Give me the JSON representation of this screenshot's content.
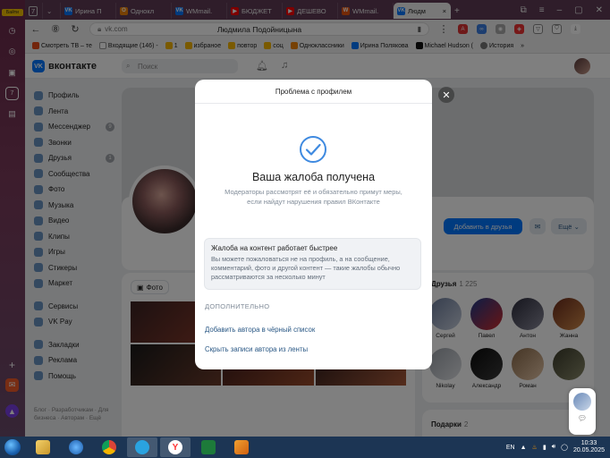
{
  "browser": {
    "weather_label": "Байти",
    "tab_counter": "7",
    "tabs": [
      {
        "label": "Ирина П",
        "color": "#0077ff",
        "glyph": "VK"
      },
      {
        "label": "Однокл",
        "color": "#ee8208",
        "glyph": "О"
      },
      {
        "label": "WMmail.",
        "color": "#0077ff",
        "glyph": "VK"
      },
      {
        "label": "БЮДЖЕТ",
        "color": "#ff0000",
        "glyph": "▶"
      },
      {
        "label": "ДЕШЕВО",
        "color": "#ff0000",
        "glyph": "▶"
      },
      {
        "label": "WMmail.",
        "color": "#e8540f",
        "glyph": "W"
      },
      {
        "label": "Людм",
        "color": "#0077ff",
        "glyph": "VK"
      }
    ],
    "url_host": "vk.com",
    "page_title": "Людмила Подойницына",
    "bookmarks": [
      {
        "label": "Смотреть ТВ – те",
        "color": "#e64a19"
      },
      {
        "label": "Входящие (146) -",
        "color": "#ffffff"
      },
      {
        "label": "1",
        "color": "#f5b400"
      },
      {
        "label": "избраное",
        "color": "#f5b400"
      },
      {
        "label": "повтор",
        "color": "#f5b400"
      },
      {
        "label": "соц",
        "color": "#f5b400"
      },
      {
        "label": "Одноклассники",
        "color": "#ee8208"
      },
      {
        "label": "Ирина Полякова",
        "color": "#0077ff"
      },
      {
        "label": "Michael Hudson (",
        "color": "#111111"
      },
      {
        "label": "История",
        "color": "#777777"
      }
    ]
  },
  "vk": {
    "logo": "вконтакте",
    "search_placeholder": "Поиск",
    "nav": [
      {
        "label": "Профиль"
      },
      {
        "label": "Лента"
      },
      {
        "label": "Мессенджер",
        "count": "9"
      },
      {
        "label": "Звонки"
      },
      {
        "label": "Друзья",
        "count": "1"
      },
      {
        "label": "Сообщества"
      },
      {
        "label": "Фото"
      },
      {
        "label": "Музыка"
      },
      {
        "label": "Видео"
      },
      {
        "label": "Клипы"
      },
      {
        "label": "Игры"
      },
      {
        "label": "Стикеры"
      },
      {
        "label": "Маркет"
      }
    ],
    "nav2": [
      {
        "label": "Сервисы"
      },
      {
        "label": "VK Pay"
      }
    ],
    "nav3": [
      {
        "label": "Закладки"
      },
      {
        "label": "Реклама"
      },
      {
        "label": "Помощь"
      }
    ],
    "footer": "Блог · Разработчикам · Для бизнеса · Авторам · Ещё",
    "add_friend": "Добавить в друзья",
    "more": "Ещё",
    "photos_tab": "Фото",
    "friends_title": "Друзья",
    "friends_count": "1 225",
    "friends": [
      {
        "name": "Сергей"
      },
      {
        "name": "Павел"
      },
      {
        "name": "Антон"
      },
      {
        "name": "Жанна"
      },
      {
        "name": "Nikolay"
      },
      {
        "name": "Александр"
      },
      {
        "name": "Роман"
      },
      {
        "name": ""
      }
    ],
    "gifts_title": "Подарки",
    "gifts_count": "2"
  },
  "modal": {
    "header": "Проблема с профилем",
    "title": "Ваша жалоба получена",
    "description": "Модераторы рассмотрят её и обязательно примут меры, если найдут нарушения правил ВКонтакте",
    "info_title": "Жалоба на контент работает быстрее",
    "info_text": "Вы можете пожаловаться не на профиль, а на сообщение, комментарий, фото и другой контент — такие жалобы обычно рассматриваются за несколько минут",
    "more_label": "ДОПОЛНИТЕЛЬНО",
    "link_blacklist": "Добавить автора в чёрный список",
    "link_hide": "Скрыть записи автора из ленты"
  },
  "taskbar": {
    "lang": "EN",
    "time": "10:33",
    "date": "20.05.2025"
  },
  "colors": {
    "accent": "#0077ff",
    "link": "#2a5885",
    "check": "#3f8ae0"
  }
}
